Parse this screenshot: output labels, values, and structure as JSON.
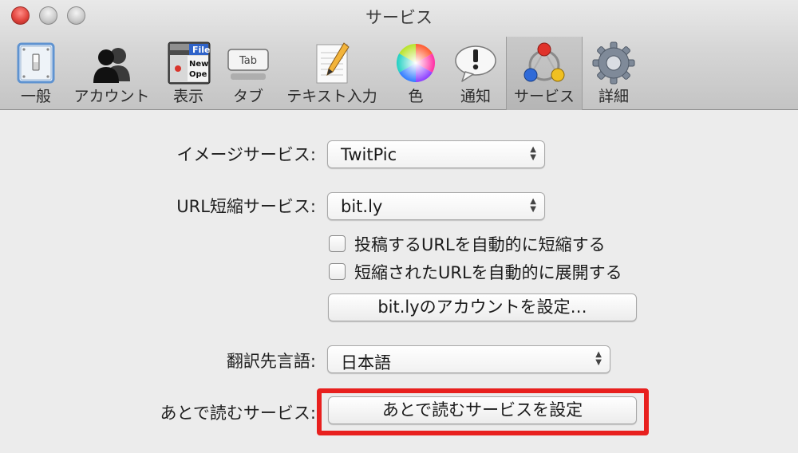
{
  "window": {
    "title": "サービス"
  },
  "toolbar": {
    "items": [
      {
        "label": "一般",
        "icon": "general-switch-icon"
      },
      {
        "label": "アカウント",
        "icon": "accounts-people-icon"
      },
      {
        "label": "表示",
        "icon": "display-window-icon"
      },
      {
        "label": "タブ",
        "icon": "tab-icon"
      },
      {
        "label": "テキスト入力",
        "icon": "text-input-pencil-icon"
      },
      {
        "label": "色",
        "icon": "color-wheel-icon"
      },
      {
        "label": "通知",
        "icon": "notification-bubble-icon"
      },
      {
        "label": "サービス",
        "icon": "services-icon",
        "selected": true
      },
      {
        "label": "詳細",
        "icon": "advanced-gear-icon"
      }
    ],
    "icon_text": {
      "file": "File",
      "new": "New",
      "open": "Ope",
      "tab": "Tab"
    }
  },
  "services": {
    "image_service": {
      "label": "イメージサービス:",
      "value": "TwitPic"
    },
    "url_shortener": {
      "label": "URL短縮サービス:",
      "value": "bit.ly"
    },
    "auto_shorten": {
      "label": "投稿するURLを自動的に短縮する",
      "checked": false
    },
    "auto_expand": {
      "label": "短縮されたURLを自動的に展開する",
      "checked": false
    },
    "account_button": "bit.lyのアカウントを設定…",
    "translation": {
      "label": "翻訳先言語:",
      "value": "日本語"
    },
    "read_later": {
      "label": "あとで読むサービス:",
      "button": "あとで読むサービスを設定"
    }
  },
  "colors": {
    "highlight": "#e8201e",
    "toolbar_bg": "#d6d6d6",
    "content_bg": "#ececec"
  }
}
